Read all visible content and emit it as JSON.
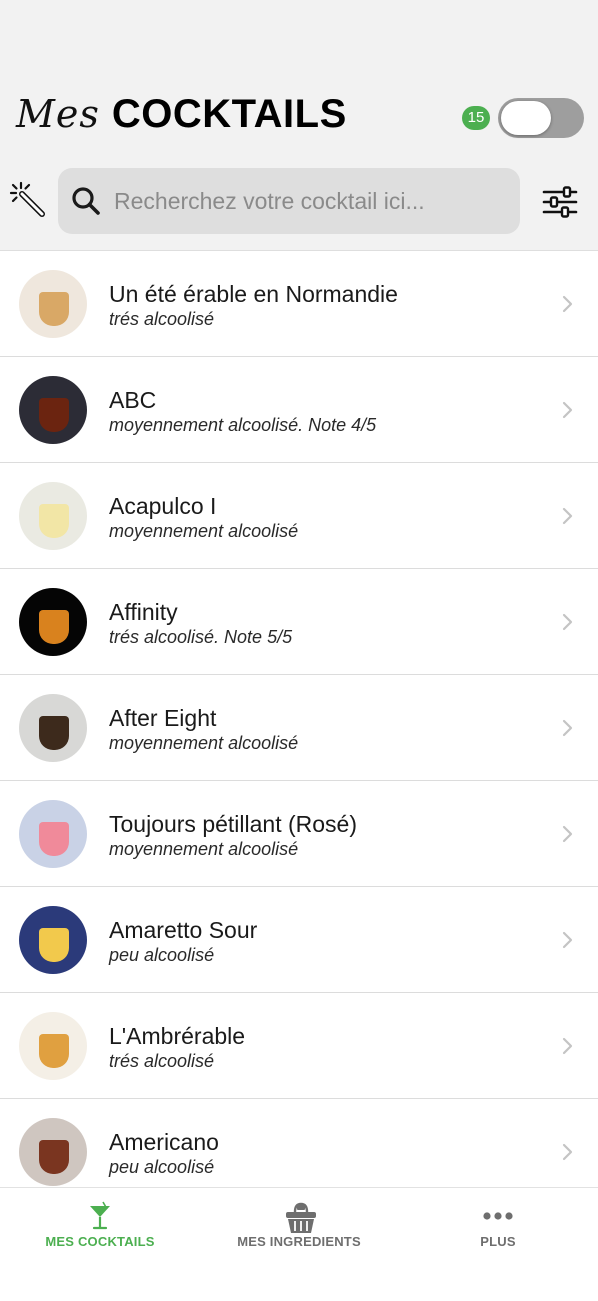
{
  "header": {
    "title_script": "Mes",
    "title_bold": "COCKTAILS",
    "count_badge": "15",
    "toggle_on": false
  },
  "search": {
    "placeholder": "Recherchez votre cocktail ici...",
    "value": ""
  },
  "icons": {
    "wand": "magic-wand-icon",
    "search": "search-icon",
    "filter": "filter-sliders-icon",
    "chevron": "chevron-right-icon"
  },
  "cocktails": [
    {
      "name": "Un été érable en Normandie",
      "subtitle": "trés alcoolisé",
      "color": "#d9a866",
      "bg": "#efe7dd"
    },
    {
      "name": "ABC",
      "subtitle": "moyennement alcoolisé. Note 4/5",
      "color": "#6b2410",
      "bg": "#2c2c36"
    },
    {
      "name": "Acapulco I",
      "subtitle": "moyennement alcoolisé",
      "color": "#f2e6a6",
      "bg": "#eaeae2"
    },
    {
      "name": "Affinity",
      "subtitle": "trés alcoolisé. Note 5/5",
      "color": "#d9821e",
      "bg": "#050505"
    },
    {
      "name": "After Eight",
      "subtitle": "moyennement alcoolisé",
      "color": "#3d2a1c",
      "bg": "#d8d8d6"
    },
    {
      "name": "Toujours pétillant (Rosé)",
      "subtitle": "moyennement alcoolisé",
      "color": "#f08a9a",
      "bg": "#c9d2e6"
    },
    {
      "name": "Amaretto Sour",
      "subtitle": "peu alcoolisé",
      "color": "#f2c94c",
      "bg": "#2b3a7a"
    },
    {
      "name": "L'Ambrérable",
      "subtitle": "trés alcoolisé",
      "color": "#e0a040",
      "bg": "#f4efe6"
    },
    {
      "name": "Americano",
      "subtitle": "peu alcoolisé",
      "color": "#7a3520",
      "bg": "#cfc6c0"
    }
  ],
  "tabs": [
    {
      "label": "MES COCKTAILS",
      "icon": "cocktail-glass-icon",
      "active": true
    },
    {
      "label": "MES INGREDIENTS",
      "icon": "basket-icon",
      "active": false
    },
    {
      "label": "PLUS",
      "icon": "more-dots-icon",
      "active": false
    }
  ],
  "colors": {
    "accent_green": "#4caf50",
    "tab_inactive": "#6e6e6e",
    "toggle_off": "#9e9e9e"
  }
}
